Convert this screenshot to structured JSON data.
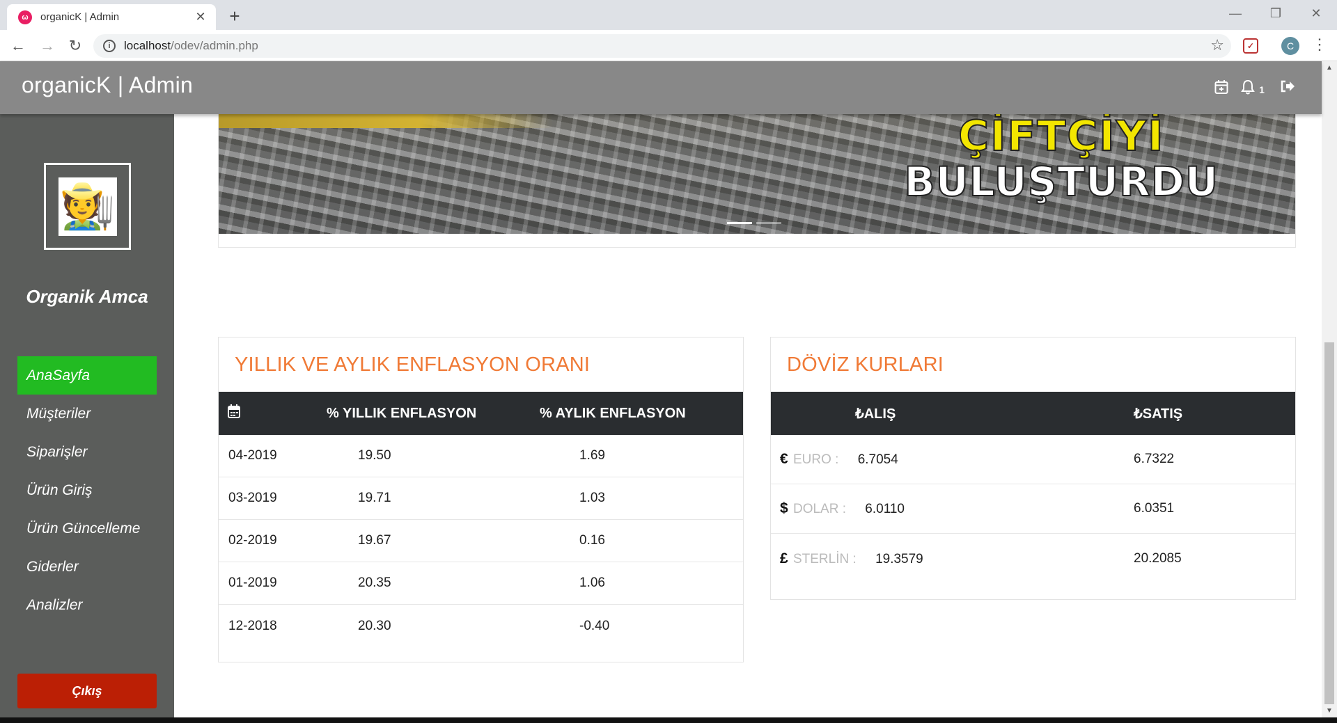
{
  "browser": {
    "tab_title": "organicK | Admin",
    "favicon_text": "ω",
    "close_glyph": "✕",
    "new_tab_glyph": "+",
    "url_host": "localhost",
    "url_path": "/odev/admin.php",
    "profile_initial": "C"
  },
  "header": {
    "brand": "organicK | Admin",
    "notification_count": "1"
  },
  "sidebar": {
    "user_name": "Organik Amca",
    "avatar_emoji": "🧑‍🌾",
    "items": [
      {
        "label": "AnaSayfa",
        "active": true
      },
      {
        "label": "Müşteriler"
      },
      {
        "label": "Siparişler"
      },
      {
        "label": "Ürün Giriş"
      },
      {
        "label": "Ürün Güncelleme"
      },
      {
        "label": "Giderler"
      },
      {
        "label": "Analizler"
      }
    ],
    "logout_label": "Çıkış"
  },
  "banner": {
    "line1": "ÇİFTÇİYİ",
    "line2": "BULUŞTURDU"
  },
  "inflation": {
    "title": "YILLIK VE AYLIK ENFLASYON ORANI",
    "col_yearly": "% YILLIK ENFLASYON",
    "col_monthly": "% AYLIK ENFLASYON",
    "rows": [
      {
        "date": "04-2019",
        "yearly": "19.50",
        "monthly": "1.69"
      },
      {
        "date": "03-2019",
        "yearly": "19.71",
        "monthly": "1.03"
      },
      {
        "date": "02-2019",
        "yearly": "19.67",
        "monthly": "0.16"
      },
      {
        "date": "01-2019",
        "yearly": "20.35",
        "monthly": "1.06"
      },
      {
        "date": "12-2018",
        "yearly": "20.30",
        "monthly": "-0.40"
      }
    ]
  },
  "currency": {
    "title": "DÖVİZ KURLARI",
    "col_buy": "₺ALIŞ",
    "col_sell": "₺SATIŞ",
    "rows": [
      {
        "symbol": "€",
        "name": "EURO :",
        "buy": "6.7054",
        "sell": "6.7322"
      },
      {
        "symbol": "$",
        "name": "DOLAR :",
        "buy": "6.0110",
        "sell": "6.0351"
      },
      {
        "symbol": "£",
        "name": "STERLİN :",
        "buy": "19.3579",
        "sell": "20.2085"
      }
    ]
  },
  "colors": {
    "accent_orange": "#f07a36",
    "sidebar_bg": "#5b5d5b",
    "active_green": "#22bb22",
    "logout_red": "#bb1f05",
    "header_gray": "#888888",
    "table_head": "#2a2d30"
  }
}
